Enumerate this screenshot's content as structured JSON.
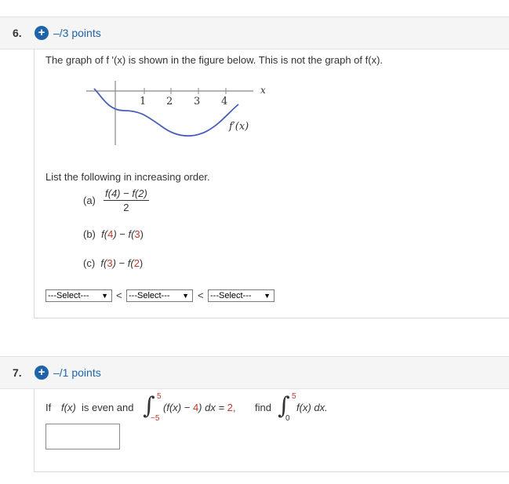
{
  "q6": {
    "number": "6.",
    "points": "–/3 points",
    "prompt": "The graph of f '(x) is shown in the figure below. This is not the graph of f(x).",
    "graph": {
      "x_axis_label": "x",
      "tick_labels": [
        "1",
        "2",
        "3",
        "4"
      ],
      "curve_label": "f′(x)"
    },
    "instruction": "List the following in increasing order.",
    "item_a_label": "(a)",
    "item_a_numerator": "f(4) − f(2)",
    "item_a_denominator": "2",
    "item_b_label": "(b)",
    "item_b_part1": "f(",
    "item_b_val1": "4",
    "item_b_part2": ") − f(",
    "item_b_val2": "3",
    "item_b_part3": ")",
    "item_c_label": "(c)",
    "item_c_part1": "f(",
    "item_c_val1": "3",
    "item_c_part2": ") − f(",
    "item_c_val2": "2",
    "item_c_part3": ")",
    "selects": [
      "---Select---",
      "---Select---",
      "---Select---"
    ],
    "less_than": "<"
  },
  "q7": {
    "number": "7.",
    "points": "–/1 points",
    "prefix": "If",
    "fx": "f(x)",
    "is_even_and": "is even and",
    "int1_upper": "5",
    "int1_lower": "−5",
    "integrand1_open": "(f(x) −",
    "integrand1_val": "4",
    "integrand1_close": ") dx =",
    "int1_value": "2,",
    "find": "find",
    "int2_upper": "5",
    "int2_lower": "0",
    "integrand2": "f(x) dx."
  },
  "colors": {
    "accent": "#1f64a8",
    "number_red": "#c0392b",
    "header_bg": "#f5f5f5"
  }
}
